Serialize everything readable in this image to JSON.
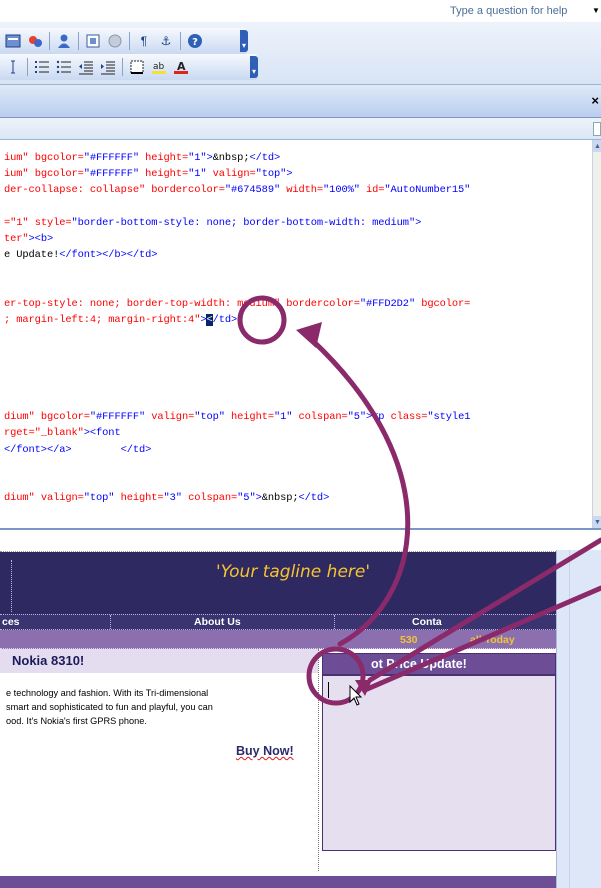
{
  "help": {
    "placeholder": "Type a question for help",
    "arrow": "▼"
  },
  "toolbar": {
    "row1_icons": [
      "format-icon",
      "spellcheck-icon",
      "divider",
      "user-icon",
      "divider",
      "table-icon",
      "circle-icon",
      "divider",
      "pilcrow-icon",
      "anchor-icon",
      "divider",
      "help-icon"
    ],
    "row2_icons": [
      "cursor-icon",
      "divider",
      "bullets-icon",
      "numbering-icon",
      "decrease-indent-icon",
      "increase-indent-icon",
      "divider",
      "border-icon",
      "highlight-icon",
      "font-color-icon"
    ],
    "pilcrow": "¶",
    "anchor": "⚓",
    "help": "?",
    "grip": "▾"
  },
  "pane": {
    "close": "×"
  },
  "code_lines": [
    {
      "parts": [
        [
          "a",
          "ium\" "
        ],
        [
          "a",
          "bgcolor="
        ],
        [
          "v",
          "\"#FFFFFF\" "
        ],
        [
          "a",
          "height="
        ],
        [
          "v",
          "\"1\""
        ],
        [
          "v",
          ">"
        ],
        [
          "k",
          "&nbsp;"
        ],
        [
          "v",
          "</td>"
        ]
      ]
    },
    {
      "parts": [
        [
          "a",
          "ium\" "
        ],
        [
          "a",
          "bgcolor="
        ],
        [
          "v",
          "\"#FFFFFF\" "
        ],
        [
          "a",
          "height="
        ],
        [
          "v",
          "\"1\" "
        ],
        [
          "a",
          "valign="
        ],
        [
          "v",
          "\"top\">"
        ]
      ]
    },
    {
      "parts": [
        [
          "a",
          "der-collapse: collapse\" "
        ],
        [
          "a",
          "bordercolor="
        ],
        [
          "v",
          "\"#674589\" "
        ],
        [
          "a",
          "width="
        ],
        [
          "v",
          "\"100%\" "
        ],
        [
          "a",
          "id="
        ],
        [
          "v",
          "\"AutoNumber15\""
        ]
      ]
    },
    {
      "parts": [
        [
          "k",
          ""
        ]
      ]
    },
    {
      "parts": [
        [
          "a",
          "=\"1\" "
        ],
        [
          "a",
          "style="
        ],
        [
          "v",
          "\"border-bottom-style: none; border-bottom-width: medium\">"
        ]
      ]
    },
    {
      "parts": [
        [
          "a",
          "ter\""
        ],
        [
          "v",
          "><b>"
        ]
      ]
    },
    {
      "parts": [
        [
          "k",
          "e Update!"
        ],
        [
          "v",
          "</font></b></td>"
        ]
      ]
    },
    {
      "parts": [
        [
          "k",
          ""
        ]
      ]
    },
    {
      "parts": [
        [
          "k",
          ""
        ]
      ]
    },
    {
      "parts": [
        [
          "a",
          "er-top-style: none; border-top-width: medium\" "
        ],
        [
          "a",
          "bordercolor="
        ],
        [
          "v",
          "\"#FFD2D2\" "
        ],
        [
          "a",
          "bgcolor="
        ]
      ]
    },
    {
      "parts": [
        [
          "a",
          "; margin-left:4; margin-right:4\""
        ],
        [
          "v",
          ">"
        ],
        [
          "sel",
          "<"
        ],
        [
          "v",
          "/td>"
        ]
      ]
    },
    {
      "parts": [
        [
          "k",
          ""
        ]
      ]
    },
    {
      "parts": [
        [
          "k",
          ""
        ]
      ]
    },
    {
      "parts": [
        [
          "k",
          ""
        ]
      ]
    },
    {
      "parts": [
        [
          "k",
          ""
        ]
      ]
    },
    {
      "parts": [
        [
          "k",
          ""
        ]
      ]
    },
    {
      "parts": [
        [
          "a",
          "dium\" "
        ],
        [
          "a",
          "bgcolor="
        ],
        [
          "v",
          "\"#FFFFFF\" "
        ],
        [
          "a",
          "valign="
        ],
        [
          "v",
          "\"top\" "
        ],
        [
          "a",
          "height="
        ],
        [
          "v",
          "\"1\" "
        ],
        [
          "a",
          "colspan="
        ],
        [
          "v",
          "\"5\"><p "
        ],
        [
          "a",
          "class="
        ],
        [
          "v",
          "\"style1"
        ]
      ]
    },
    {
      "parts": [
        [
          "a",
          "rget=\"_blank\""
        ],
        [
          "v",
          "><font"
        ]
      ]
    },
    {
      "parts": [
        [
          "v",
          "</font></a>        </td>"
        ]
      ]
    },
    {
      "parts": [
        [
          "k",
          ""
        ]
      ]
    },
    {
      "parts": [
        [
          "k",
          ""
        ]
      ]
    },
    {
      "parts": [
        [
          "a",
          "dium\" "
        ],
        [
          "a",
          "valign="
        ],
        [
          "v",
          "\"top\" "
        ],
        [
          "a",
          "height="
        ],
        [
          "v",
          "\"3\" "
        ],
        [
          "a",
          "colspan="
        ],
        [
          "v",
          "\"5\">"
        ],
        [
          "k",
          "&nbsp;"
        ],
        [
          "v",
          "</td>"
        ]
      ]
    }
  ],
  "design": {
    "tagline": "'Your tagline here'",
    "nav": [
      "ces",
      "About Us",
      "Conta"
    ],
    "phone": "530",
    "call": "all Today",
    "product_title": "Nokia 8310!",
    "description": [
      "e technology and fashion. With its Tri-dimensional",
      "smart and sophisticated to fun and playful, you can",
      "ood. It's Nokia's first GPRS phone."
    ],
    "buy_now": "Buy Now!",
    "side_header": "ot Price Update!"
  },
  "colors": {
    "annotation": "#8b2a6b",
    "banner": "#2e2961",
    "accent": "#6d4d96",
    "tagline": "#f5c430"
  }
}
